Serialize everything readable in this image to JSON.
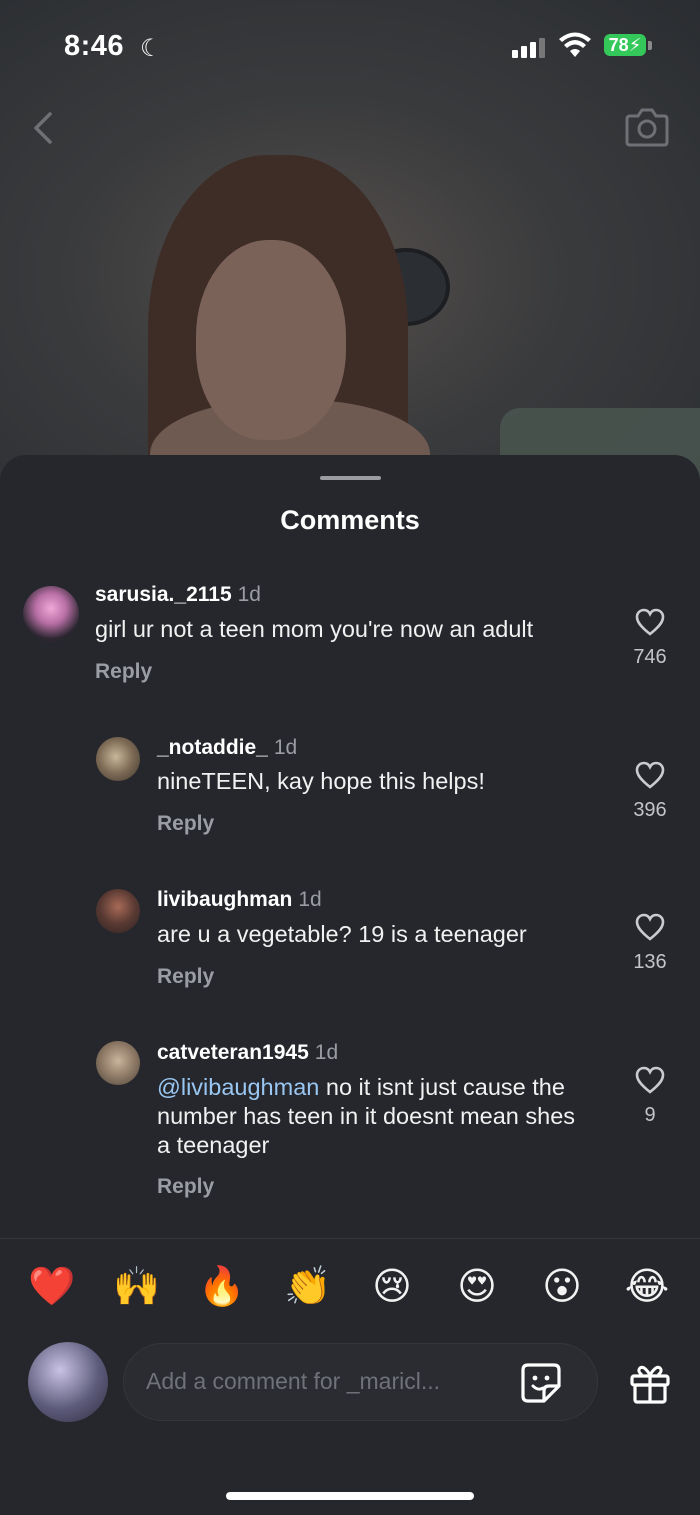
{
  "status": {
    "time": "8:46",
    "battery": "78"
  },
  "sheet": {
    "title": "Comments"
  },
  "comments": [
    {
      "username": "sarusia._2115",
      "time": "1d",
      "text": "girl ur not a teen mom you're now an adult",
      "reply_label": "Reply",
      "likes": "746"
    },
    {
      "username": "_notaddie_",
      "time": "1d",
      "text": "nineTEEN, kay hope this helps!",
      "reply_label": "Reply",
      "likes": "396"
    },
    {
      "username": "livibaughman",
      "time": "1d",
      "text": "are u a vegetable? 19 is a teenager",
      "reply_label": "Reply",
      "likes": "136"
    },
    {
      "username": "catveteran1945",
      "time": "1d",
      "mention": "@livibaughman",
      "text": " no it isnt just cause the number has teen in it doesnt mean shes a teenager",
      "reply_label": "Reply",
      "likes": "9"
    }
  ],
  "emojis": [
    "❤️",
    "🙌",
    "🔥",
    "👏",
    "😢",
    "😍",
    "😮",
    "😂"
  ],
  "composer": {
    "placeholder": "Add a comment for _maricl..."
  },
  "icons": {
    "back": "chevron-left-icon",
    "camera": "camera-icon",
    "heart": "heart-outline-icon",
    "sticker": "sticker-icon",
    "gift": "gift-icon"
  }
}
